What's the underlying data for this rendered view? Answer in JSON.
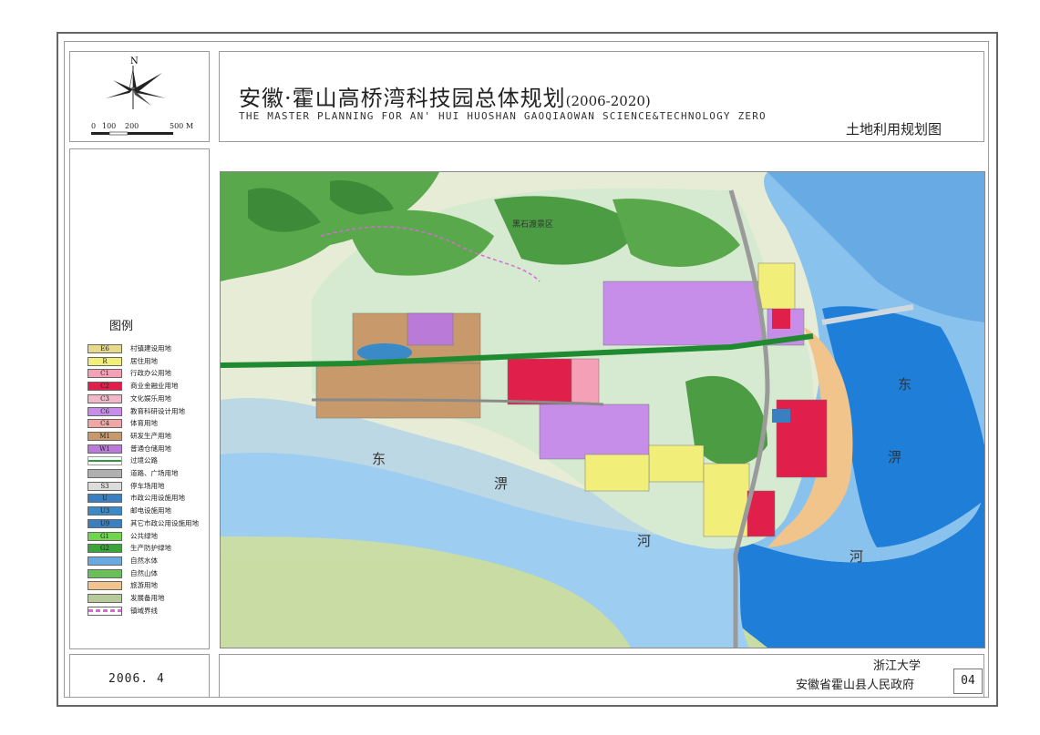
{
  "title": {
    "cn_main": "安徽·霍山高桥湾科技园总体规划",
    "cn_years": "(2006-2020)",
    "en": "THE MASTER PLANNING FOR AN' HUI HUOSHAN GAOQIAOWAN SCIENCE&TECHNOLOGY ZERO",
    "subtitle": "土地利用规划图"
  },
  "north_arrow": {
    "label": "N",
    "icon": "compass-rose-icon"
  },
  "scale_bar": {
    "labels": [
      "0",
      "100",
      "200",
      "500 M"
    ]
  },
  "legend": {
    "title": "图例",
    "items": [
      {
        "code": "E6",
        "label": "村镇建设用地",
        "color": "#e6d98a"
      },
      {
        "code": "R",
        "label": "居住用地",
        "color": "#f2ee7a"
      },
      {
        "code": "C1",
        "label": "行政办公用地",
        "color": "#f4a0b6"
      },
      {
        "code": "C2",
        "label": "商业金融业用地",
        "color": "#e0204a"
      },
      {
        "code": "C3",
        "label": "文化娱乐用地",
        "color": "#f0b8c8"
      },
      {
        "code": "C6",
        "label": "教育科研设计用地",
        "color": "#c68ee8"
      },
      {
        "code": "C4",
        "label": "体育用地",
        "color": "#f2a5a5"
      },
      {
        "code": "M1",
        "label": "研发生产用地",
        "color": "#c8996a"
      },
      {
        "code": "W1",
        "label": "普通仓储用地",
        "color": "#b97ad8"
      },
      {
        "code": "",
        "label": "过境公路",
        "color": "#2e9a3a"
      },
      {
        "code": "",
        "label": "道路、广场用地",
        "color": "#b0b0b0"
      },
      {
        "code": "S3",
        "label": "停车场用地",
        "color": "#dcdcdc"
      },
      {
        "code": "U",
        "label": "市政公用设施用地",
        "color": "#3a7fc0"
      },
      {
        "code": "U3",
        "label": "邮电设施用地",
        "color": "#3a8ac8"
      },
      {
        "code": "U9",
        "label": "其它市政公用设施用地",
        "color": "#3a7fc0"
      },
      {
        "code": "G1",
        "label": "公共绿地",
        "color": "#6ed64a"
      },
      {
        "code": "G2",
        "label": "生产防护绿地",
        "color": "#3aa63a"
      },
      {
        "code": "",
        "label": "自然水体",
        "color": "#6aa8e0"
      },
      {
        "code": "",
        "label": "自然山体",
        "color": "#6bbf5a"
      },
      {
        "code": "",
        "label": "旅游用地",
        "color": "#f0c48a"
      },
      {
        "code": "",
        "label": "发展备用地",
        "color": "#b8c99a"
      },
      {
        "code": "",
        "label": "镇域界线",
        "color": "#d66ad6"
      }
    ]
  },
  "map": {
    "labels": {
      "river_east_1": "东",
      "river_wei_1": "淠",
      "river_he_1": "河",
      "river_east_2": "东",
      "river_wei_2": "淠",
      "river_he_2": "河",
      "scenic_area": "黑石渡景区"
    },
    "colors": {
      "background": "#e8ecd8",
      "farmland": "#c9dca8",
      "river": "#1f7fd8",
      "river_light": "#86c0ee",
      "floodplain": "#b8d8e8",
      "mountain": "#55a848",
      "highway": "#1f8a30",
      "road": "#8a8a8a"
    }
  },
  "footer": {
    "date": "2006. 4",
    "org1": "浙江大学",
    "org2": "安徽省霍山县人民政府",
    "sheet_no": "04"
  }
}
